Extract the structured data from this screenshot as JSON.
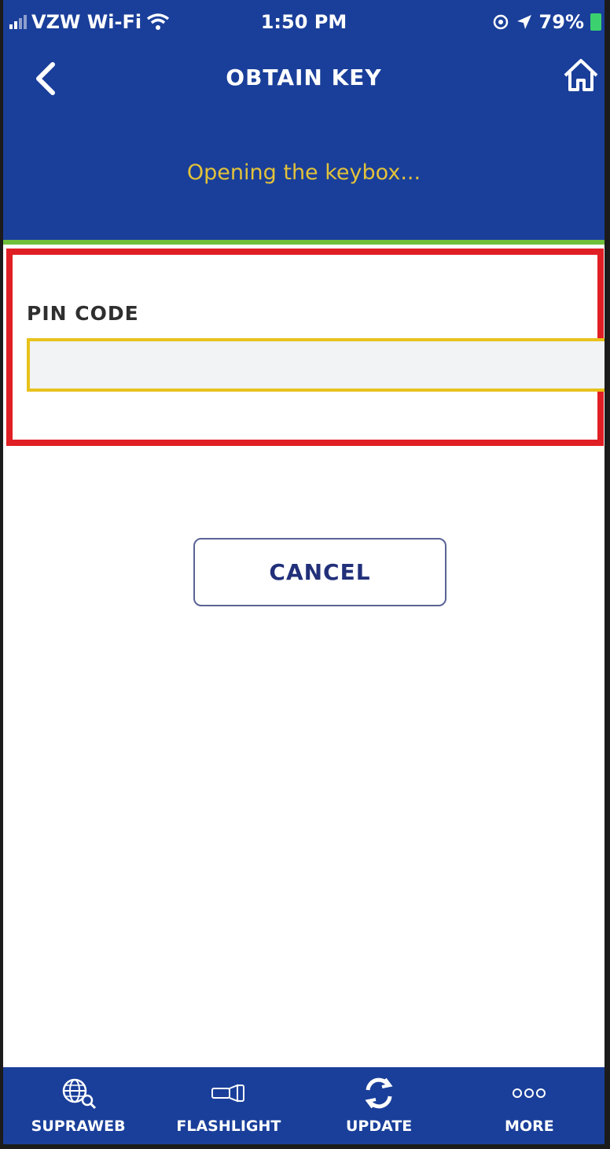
{
  "status_bar": {
    "carrier": "VZW Wi-Fi",
    "time": "1:50 PM",
    "battery": "79%"
  },
  "header": {
    "title": "OBTAIN KEY",
    "status_message": "Opening the keybox..."
  },
  "form": {
    "pin_label": "PIN CODE",
    "pin_value": ""
  },
  "actions": {
    "cancel_label": "CANCEL"
  },
  "tabbar": {
    "items": [
      {
        "label": "SUPRAWEB",
        "icon": "globe-search-icon"
      },
      {
        "label": "FLASHLIGHT",
        "icon": "flashlight-icon"
      },
      {
        "label": "UPDATE",
        "icon": "sync-icon"
      },
      {
        "label": "MORE",
        "icon": "more-dots-icon"
      }
    ]
  },
  "colors": {
    "primary": "#1a3f9a",
    "status_text": "#e2c23a",
    "highlight": "#e01f24",
    "input_border": "#e8c21c",
    "progress": "#6fbf3a"
  }
}
